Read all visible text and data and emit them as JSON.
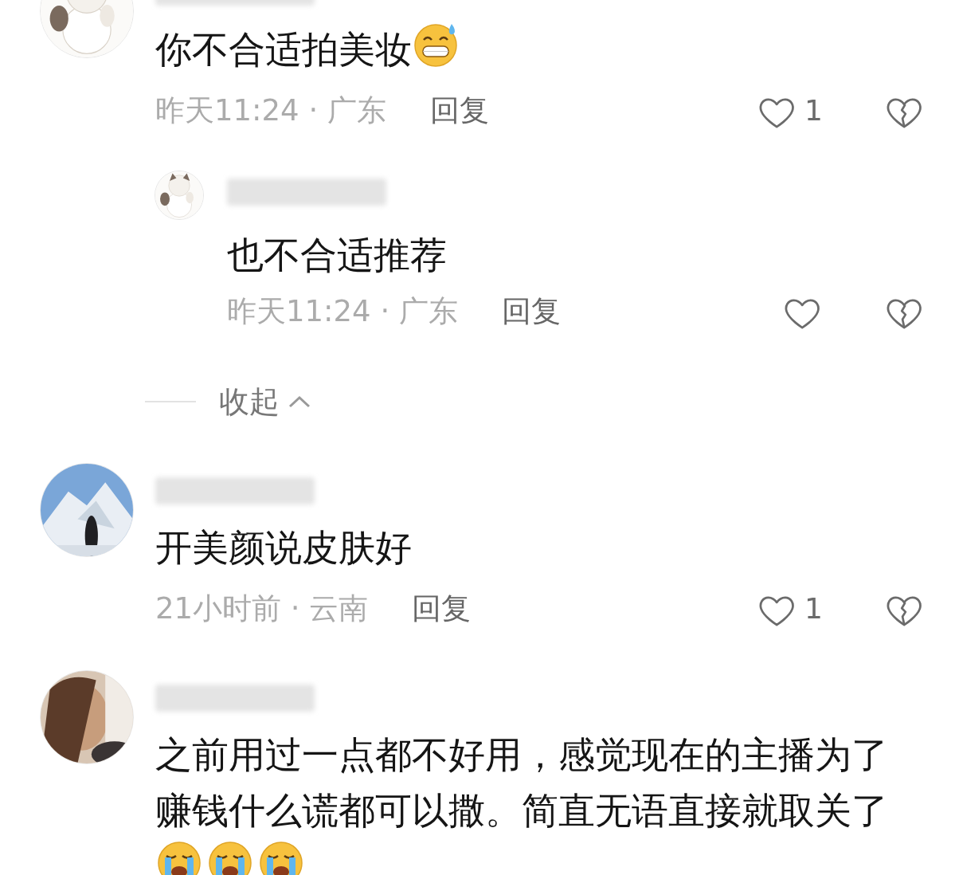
{
  "comments": [
    {
      "name_redacted": true,
      "text": "你不合适拍美妆",
      "emojis": [
        {
          "kind": "sweat_grin"
        }
      ],
      "time_place": "昨天11:24 · 广东",
      "reply_label": "回复",
      "likes": "1",
      "replies": [
        {
          "name_redacted": true,
          "text": "也不合适推荐",
          "time_place": "昨天11:24 · 广东",
          "reply_label": "回复"
        }
      ],
      "collapse_label": "收起"
    },
    {
      "name_redacted": true,
      "text": "开美颜说皮肤好",
      "time_place": "21小时前 · 云南",
      "reply_label": "回复",
      "likes": "1"
    },
    {
      "name_redacted": true,
      "text": "之前用过一点都不好用，感觉现在的主播为了赚钱什么谎都可以撒。简直无语直接就取关了",
      "emojis": [
        {
          "kind": "crying"
        },
        {
          "kind": "crying"
        },
        {
          "kind": "crying"
        }
      ]
    }
  ]
}
